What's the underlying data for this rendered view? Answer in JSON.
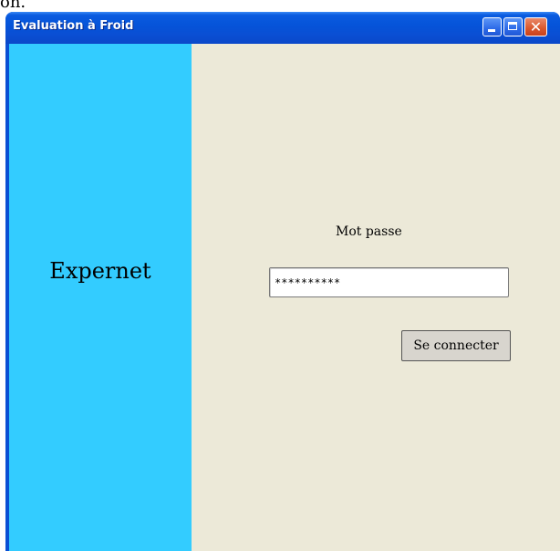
{
  "background_caption": "on.",
  "window": {
    "title": "Evaluation à Froid",
    "controls": {
      "minimize": "minimize-icon",
      "maximize": "maximize-icon",
      "close": "close-icon"
    }
  },
  "sidebar": {
    "brand": "Expernet",
    "color": "#33ccff"
  },
  "form": {
    "password_label": "Mot passe",
    "password_value": "**********",
    "connect_label": "Se connecter"
  },
  "colors": {
    "titlebar": "#0a4fd4",
    "client_bg": "#ece9d8",
    "close_button": "#d9572c"
  }
}
